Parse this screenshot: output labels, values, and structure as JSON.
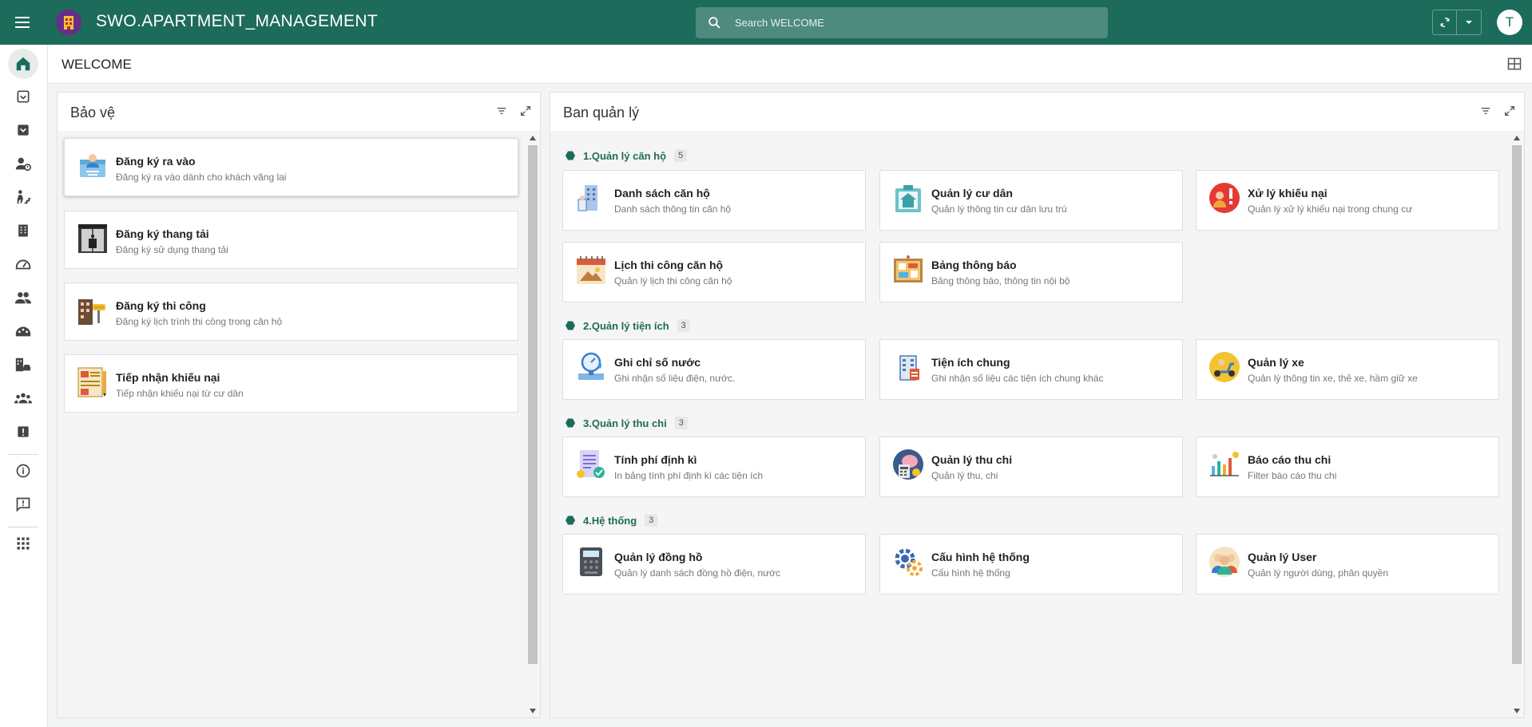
{
  "topbar": {
    "app_title": "SWO.APARTMENT_MANAGEMENT",
    "search_placeholder": "Search WELCOME",
    "avatar_initial": "T",
    "brand_color": "#1d6b5a"
  },
  "rail": {
    "items": [
      "home-icon",
      "checkbox-icon",
      "inbox-icon",
      "user-clock-icon",
      "stairs-icon",
      "building-icon",
      "dashboard-icon",
      "people-icon",
      "palette-icon",
      "building-car-icon",
      "group-settings-icon",
      "alert-icon",
      "info-icon",
      "feedback-icon",
      "apps-icon"
    ]
  },
  "page": {
    "title": "WELCOME"
  },
  "left_panel": {
    "title": "Bảo vệ",
    "cards": [
      {
        "title": "Đăng ký ra vào",
        "desc": "Đăng ký ra vào dành cho khách vãng lai",
        "icon": "visitor-card-icon"
      },
      {
        "title": "Đăng ký thang tải",
        "desc": "Đăng ký sử dụng thang tải",
        "icon": "elevator-icon"
      },
      {
        "title": "Đăng ký thi công",
        "desc": "Đăng ký lịch trình thi công trong căn hộ",
        "icon": "paint-building-icon"
      },
      {
        "title": "Tiếp nhận khiếu nại",
        "desc": "Tiếp nhận khiếu nại từ cư dân",
        "icon": "complaint-form-icon"
      }
    ]
  },
  "right_panel": {
    "title": "Ban quản lý",
    "groups": [
      {
        "name": "1.Quản lý căn hộ",
        "count": "5",
        "cards": [
          {
            "title": "Danh sách căn hộ",
            "desc": "Danh sách thông tin căn hộ",
            "icon": "apartment-list-icon"
          },
          {
            "title": "Quản lý cư dân",
            "desc": "Quản lý thông tin cư dân lưu trú",
            "icon": "resident-icon"
          },
          {
            "title": "Xử lý khiếu nại",
            "desc": "Quản lý xử lý khiếu nại trong chung cư",
            "icon": "complaint-alert-icon"
          },
          {
            "title": "Lịch thi công căn hộ",
            "desc": "Quản lý lịch thi công căn hộ",
            "icon": "construction-calendar-icon"
          },
          {
            "title": "Bảng thông báo",
            "desc": "Bảng thông báo, thông tin nội bộ",
            "icon": "notice-board-icon"
          }
        ]
      },
      {
        "name": "2.Quản lý tiện ích",
        "count": "3",
        "cards": [
          {
            "title": "Ghi chỉ số nước",
            "desc": "Ghi nhận số liệu điện, nước.",
            "icon": "water-meter-icon"
          },
          {
            "title": "Tiện ích chung",
            "desc": "Ghi nhận số liệu các tiện ích chung khác",
            "icon": "utility-building-icon"
          },
          {
            "title": "Quản lý xe",
            "desc": "Quản lý thông tin xe, thẻ xe, hầm giữ xe",
            "icon": "scooter-icon"
          }
        ]
      },
      {
        "name": "3.Quản lý thu chi",
        "count": "3",
        "cards": [
          {
            "title": "Tính phí định kì",
            "desc": "In bảng tính phí định kì các tiện ích",
            "icon": "invoice-icon"
          },
          {
            "title": "Quản lý thu chi",
            "desc": "Quản lý thu, chi",
            "icon": "piggy-calculator-icon"
          },
          {
            "title": "Báo cáo thu chi",
            "desc": "Filter báo cáo thu chi",
            "icon": "report-chart-icon"
          }
        ]
      },
      {
        "name": "4.Hệ thống",
        "count": "3",
        "cards": [
          {
            "title": "Quản lý đồng hồ",
            "desc": "Quản lý danh sách đồng hồ điện, nước",
            "icon": "meter-device-icon"
          },
          {
            "title": "Cấu hình hệ thống",
            "desc": "Cấu hình hệ thống",
            "icon": "gear-settings-icon"
          },
          {
            "title": "Quản lý User",
            "desc": "Quản lý người dùng, phân quyền",
            "icon": "users-group-icon"
          }
        ]
      }
    ]
  }
}
